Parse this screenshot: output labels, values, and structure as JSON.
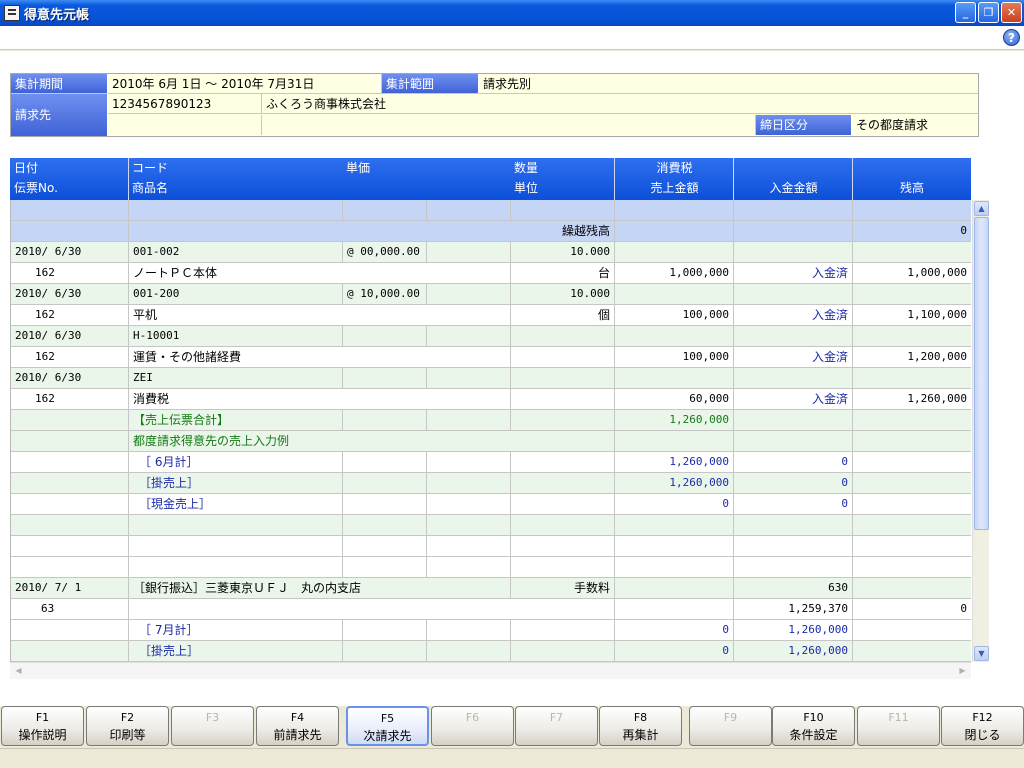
{
  "window": {
    "title": "得意先元帳"
  },
  "header": {
    "period_label": "集計期間",
    "period_value": "2010年 6月 1日 ～ 2010年 7月31日",
    "scope_label": "集計範囲",
    "scope_value": "請求先別",
    "billto_label": "請求先",
    "billto_code": "1234567890123",
    "billto_name": "ふくろう商事株式会社",
    "closing_label": "締日区分",
    "closing_value": "その都度請求"
  },
  "columns": {
    "date": "日付",
    "slip": "伝票No.",
    "code": "コード",
    "product": "商品名",
    "unit_price": "単価",
    "qty": "数量",
    "unit": "単位",
    "tax": "消費税",
    "sales": "売上金額",
    "deposit": "入金金額",
    "balance": "残高"
  },
  "rows": [
    {
      "type": "blank",
      "bg": "blue"
    },
    {
      "type": "carry",
      "label": "繰越残高",
      "balance": "0"
    },
    {
      "type": "item_top",
      "date": "2010/ 6/30",
      "code": "001-002",
      "price": "@ 00,000.00",
      "qty": "10.000"
    },
    {
      "type": "item_bottom",
      "slip": "162",
      "name": "ノートＰＣ本体",
      "unit": "台",
      "sales": "1,000,000",
      "deposit": "入金済",
      "balance": "1,000,000"
    },
    {
      "type": "item_top",
      "date": "2010/ 6/30",
      "code": "001-200",
      "price": "@ 10,000.00",
      "qty": "10.000"
    },
    {
      "type": "item_bottom",
      "slip": "162",
      "name": "平机",
      "unit": "個",
      "sales": "100,000",
      "deposit": "入金済",
      "balance": "1,100,000"
    },
    {
      "type": "item_top",
      "date": "2010/ 6/30",
      "code": "H-10001",
      "price": "",
      "qty": ""
    },
    {
      "type": "item_bottom",
      "slip": "162",
      "name": "運賃・その他諸経費",
      "unit": "",
      "sales": "100,000",
      "deposit": "入金済",
      "balance": "1,200,000"
    },
    {
      "type": "item_top",
      "date": "2010/ 6/30",
      "code": "ZEI",
      "price": "",
      "qty": ""
    },
    {
      "type": "item_bottom",
      "slip": "162",
      "name": "消費税",
      "unit": "",
      "sales": "60,000",
      "deposit": "入金済",
      "balance": "1,260,000"
    },
    {
      "type": "green_total",
      "label": "【売上伝票合計】",
      "sales": "1,260,000"
    },
    {
      "type": "green_note",
      "label": "都度請求得意先の売上入力例"
    },
    {
      "type": "sum",
      "label": "［ 6月計］",
      "sales": "1,260,000",
      "deposit": "0",
      "bg": "white"
    },
    {
      "type": "sum",
      "label": "［掛売上］",
      "sales": "1,260,000",
      "deposit": "0",
      "bg": "mint"
    },
    {
      "type": "sum",
      "label": "［現金売上］",
      "sales": "0",
      "deposit": "0",
      "bg": "white"
    },
    {
      "type": "empty",
      "bg": "mint"
    },
    {
      "type": "empty",
      "bg": "white"
    },
    {
      "type": "empty",
      "bg": "white"
    },
    {
      "type": "bank_top",
      "date": "2010/ 7/ 1",
      "desc": "［銀行振込］三菱東京ＵＦＪ　丸の内支店",
      "unit": "手数料",
      "deposit": "630"
    },
    {
      "type": "bank_bottom",
      "slip": "63",
      "deposit": "1,259,370",
      "balance": "0"
    },
    {
      "type": "sum",
      "label": "［ 7月計］",
      "sales": "0",
      "deposit": "1,260,000",
      "bg": "white"
    },
    {
      "type": "sum",
      "label": "［掛売上］",
      "sales": "0",
      "deposit": "1,260,000",
      "bg": "mint"
    }
  ],
  "fkeys": [
    {
      "key": "F1",
      "label": "操作説明",
      "enabled": true
    },
    {
      "key": "F2",
      "label": "印刷等",
      "enabled": true
    },
    {
      "key": "F3",
      "label": "",
      "enabled": false
    },
    {
      "key": "F4",
      "label": "前請求先",
      "enabled": true
    },
    {
      "key": "F5",
      "label": "次請求先",
      "enabled": true,
      "active": true
    },
    {
      "key": "F6",
      "label": "",
      "enabled": false
    },
    {
      "key": "F7",
      "label": "",
      "enabled": false
    },
    {
      "key": "F8",
      "label": "再集計",
      "enabled": true
    },
    {
      "key": "F9",
      "label": "",
      "enabled": false
    },
    {
      "key": "F10",
      "label": "条件設定",
      "enabled": true
    },
    {
      "key": "F11",
      "label": "",
      "enabled": false
    },
    {
      "key": "F12",
      "label": "閉じる",
      "enabled": true
    }
  ],
  "colors": {
    "header_blue": "#0c4fd8",
    "label_blue": "#3f63d6",
    "row_blue": "#c5d5f6",
    "row_mint": "#eaf6ea",
    "info_bg": "#ffffe4",
    "green_text": "#147a14",
    "navy_text": "#1a2aa8"
  },
  "icons": {
    "app": "ledger-icon",
    "help": "help-icon",
    "minimize": "minimize-icon",
    "restore": "restore-icon",
    "close": "close-icon"
  }
}
